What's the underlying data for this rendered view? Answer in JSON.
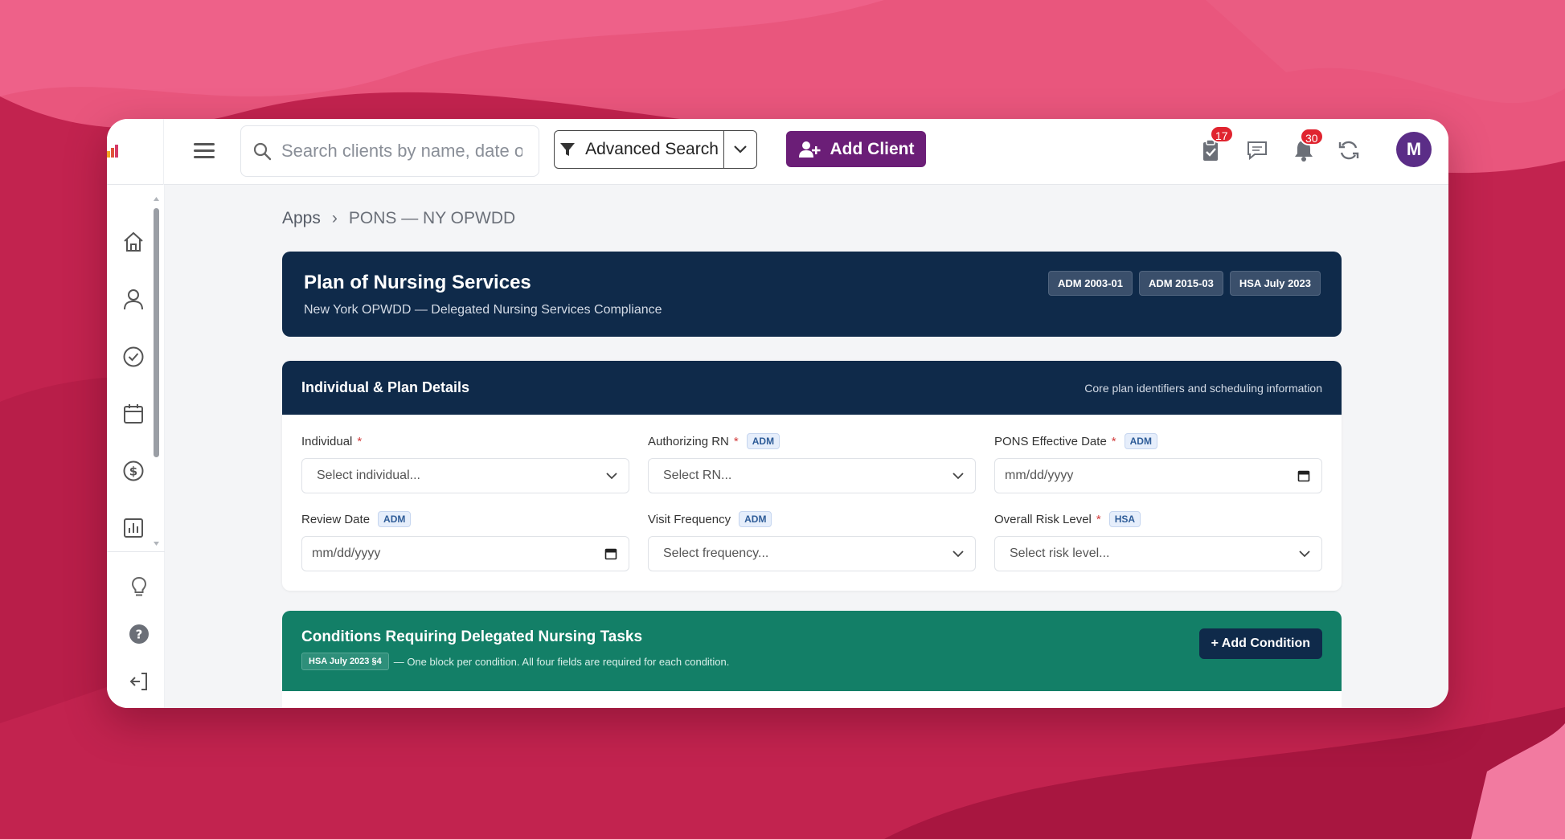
{
  "colors": {
    "background": "#c2234f",
    "navy": "#0f2a4a",
    "green": "#137f67",
    "purple": "#6b1e77",
    "badge_red": "#e0242f"
  },
  "header": {
    "search_placeholder": "Search clients by name, date of b",
    "advanced_search_label": "Advanced Search",
    "add_client_label": "Add Client",
    "tasks_badge": "17",
    "notifications_badge": "30",
    "avatar_initial": "M",
    "icons": [
      "menu-icon",
      "search-icon",
      "filter-icon",
      "chevron-down-icon",
      "add-user-icon",
      "clipboard-check-icon",
      "chat-icon",
      "bell-icon",
      "refresh-icon"
    ]
  },
  "sidebar": {
    "icons": [
      "home-icon",
      "user-icon",
      "check-circle-icon",
      "calendar-icon",
      "dollar-icon",
      "chart-icon",
      "lightbulb-icon",
      "help-icon",
      "logout-icon"
    ]
  },
  "breadcrumb": {
    "root": "Apps",
    "separator": "›",
    "current": "PONS — NY OPWDD"
  },
  "hero": {
    "title": "Plan of Nursing Services",
    "subtitle": "New York OPWDD — Delegated Nursing Services Compliance",
    "tags": [
      "ADM 2003-01",
      "ADM 2015-03",
      "HSA July 2023"
    ]
  },
  "details": {
    "title": "Individual & Plan Details",
    "subtitle": "Core plan identifiers and scheduling information",
    "fields": [
      {
        "label": "Individual",
        "required": "*",
        "pill": "",
        "value": "Select individual..."
      },
      {
        "label": "Authorizing RN",
        "required": "*",
        "pill": "ADM",
        "value": "Select RN..."
      },
      {
        "label": "PONS Effective Date",
        "required": "*",
        "pill": "ADM",
        "value": "mm/dd/yyyy"
      },
      {
        "label": "Review Date",
        "required": "",
        "pill": "ADM",
        "value": "mm/dd/yyyy"
      },
      {
        "label": "Visit Frequency",
        "required": "",
        "pill": "ADM",
        "value": "Select frequency..."
      },
      {
        "label": "Overall Risk Level",
        "required": "*",
        "pill": "HSA",
        "value": "Select risk level..."
      }
    ]
  },
  "conditions": {
    "title": "Conditions Requiring Delegated Nursing Tasks",
    "tag": "HSA July 2023 §4",
    "note": "— One block per condition. All four fields are required for each condition.",
    "add_label": "+ Add Condition"
  }
}
